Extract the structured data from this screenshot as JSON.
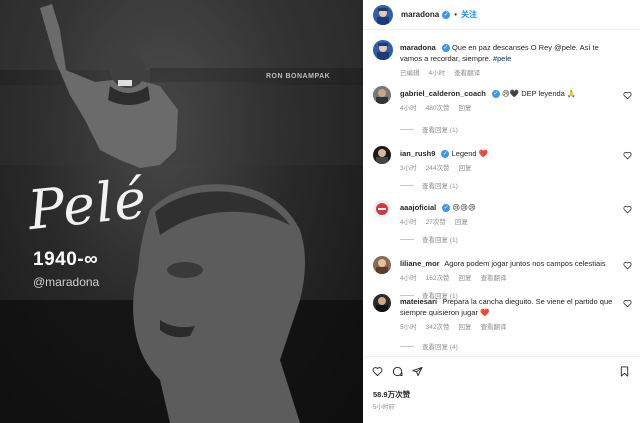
{
  "photo": {
    "signature": "Pelé",
    "years": "1940-∞",
    "handle": "@maradona",
    "stadium_sign": "RON BONAMPAK"
  },
  "header": {
    "username": "maradona",
    "separator": "•",
    "follow_label": "关注"
  },
  "caption": {
    "username": "maradona",
    "text": "Que en paz descanses O Rey @pele. Así te vamos a recordar, siempre. ",
    "hashtag": "#pele",
    "edited": "已编辑",
    "time": "4小时",
    "translate": "查看翻译"
  },
  "comments": [
    {
      "username": "gabriel_calderon_coach",
      "text": "😢🖤 DEP leyenda 🙏",
      "time": "4小时",
      "likes": "480次赞",
      "reply": "回复",
      "replies_label": "查看回复 (1)"
    },
    {
      "username": "ian_rush9",
      "text": "Legend ❤️",
      "time": "3小时",
      "likes": "244次赞",
      "reply": "回复",
      "replies_label": "查看回复 (1)"
    },
    {
      "username": "aaajoficial",
      "text": "😢😢😢",
      "time": "4小时",
      "likes": "27次赞",
      "reply": "回复",
      "replies_label": "查看回复 (1)"
    },
    {
      "username": "liliane_mor",
      "text": "Agora podem jogar juntos nos campos celestiais",
      "time": "4小时",
      "likes": "162次赞",
      "reply": "回复",
      "translate": "查看翻译",
      "replies_label": "查看回复 (1)"
    },
    {
      "username": "mateiesari",
      "text": "Prepara la cancha dieguito. Se viene el partido que siempre quisieron jugar ❤️",
      "time": "5小时",
      "likes": "342次赞",
      "reply": "回复",
      "translate": "查看翻译",
      "replies_label": "查看回复 (4)"
    }
  ],
  "footer": {
    "views": "58.9万次赞",
    "posted": "5小时前"
  },
  "colors": {
    "link": "#0095f6",
    "verified": "#3897f0",
    "like_red": "#ed4956"
  }
}
